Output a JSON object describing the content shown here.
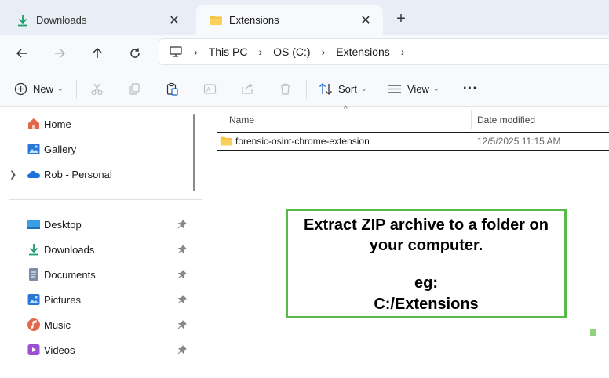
{
  "tabs": [
    {
      "label": "Downloads",
      "icon": "download-icon",
      "active": false
    },
    {
      "label": "Extensions",
      "icon": "folder-icon",
      "active": true
    }
  ],
  "breadcrumb": [
    "This PC",
    "OS (C:)",
    "Extensions"
  ],
  "commands": {
    "new_label": "New",
    "sort_label": "Sort",
    "view_label": "View",
    "more_label": "···"
  },
  "nav": {
    "top_items": [
      {
        "label": "Home",
        "icon": "home-icon"
      },
      {
        "label": "Gallery",
        "icon": "gallery-icon"
      },
      {
        "label": "Rob - Personal",
        "icon": "onedrive-icon"
      }
    ],
    "quick_access": [
      {
        "label": "Desktop",
        "icon": "desktop-icon"
      },
      {
        "label": "Downloads",
        "icon": "download-icon"
      },
      {
        "label": "Documents",
        "icon": "documents-icon"
      },
      {
        "label": "Pictures",
        "icon": "pictures-icon"
      },
      {
        "label": "Music",
        "icon": "music-icon"
      },
      {
        "label": "Videos",
        "icon": "videos-icon"
      }
    ]
  },
  "columns": {
    "name": "Name",
    "date": "Date modified"
  },
  "files": [
    {
      "name": "forensic-osint-chrome-extension",
      "date": "12/5/2025 11:15 AM",
      "type": "folder"
    }
  ],
  "callout": {
    "line1": "Extract ZIP archive to a folder on your computer.",
    "line2": "eg:",
    "line3": "C:/Extensions",
    "border_color": "#57b947"
  },
  "colors": {
    "accent_folder": "#f5c242",
    "download_green": "#1a9e6e"
  }
}
